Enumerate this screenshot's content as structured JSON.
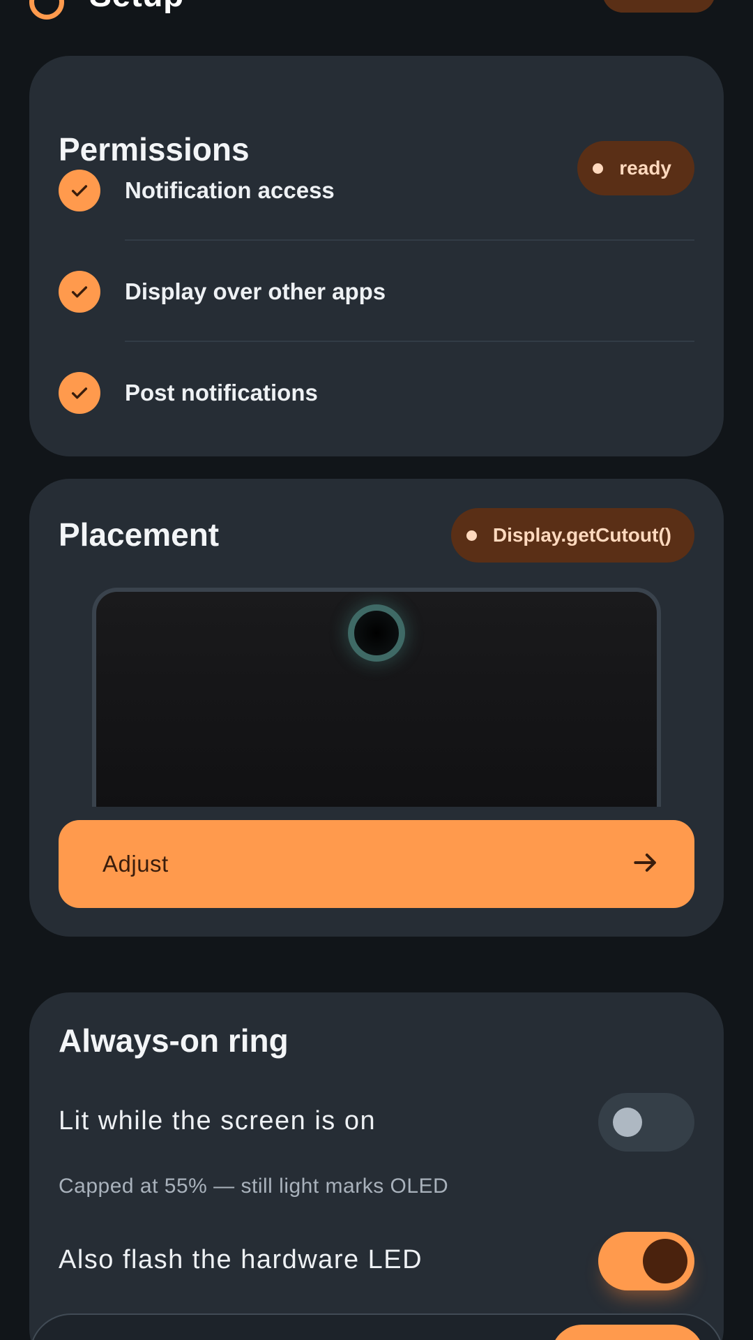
{
  "header": {
    "title": "Setup"
  },
  "permissions": {
    "title": "Permissions",
    "status": "ready",
    "items": [
      {
        "label": "Notification access",
        "granted": true
      },
      {
        "label": "Display over other apps",
        "granted": true
      },
      {
        "label": "Post notifications",
        "granted": true
      }
    ]
  },
  "placement": {
    "title": "Placement",
    "source": "Display.getCutout()",
    "adjust_label": "Adjust"
  },
  "always_on": {
    "title": "Always-on ring",
    "screen_on_label": "Lit while the screen is on",
    "screen_on_enabled": false,
    "hint": "Capped at 55% — still light marks OLED",
    "led_label": "Also flash the hardware LED",
    "led_enabled": true
  },
  "colors": {
    "accent": "#ff9a4d",
    "chip_bg": "#5a2f16",
    "card_bg": "#262d35",
    "page_bg": "#111519"
  }
}
